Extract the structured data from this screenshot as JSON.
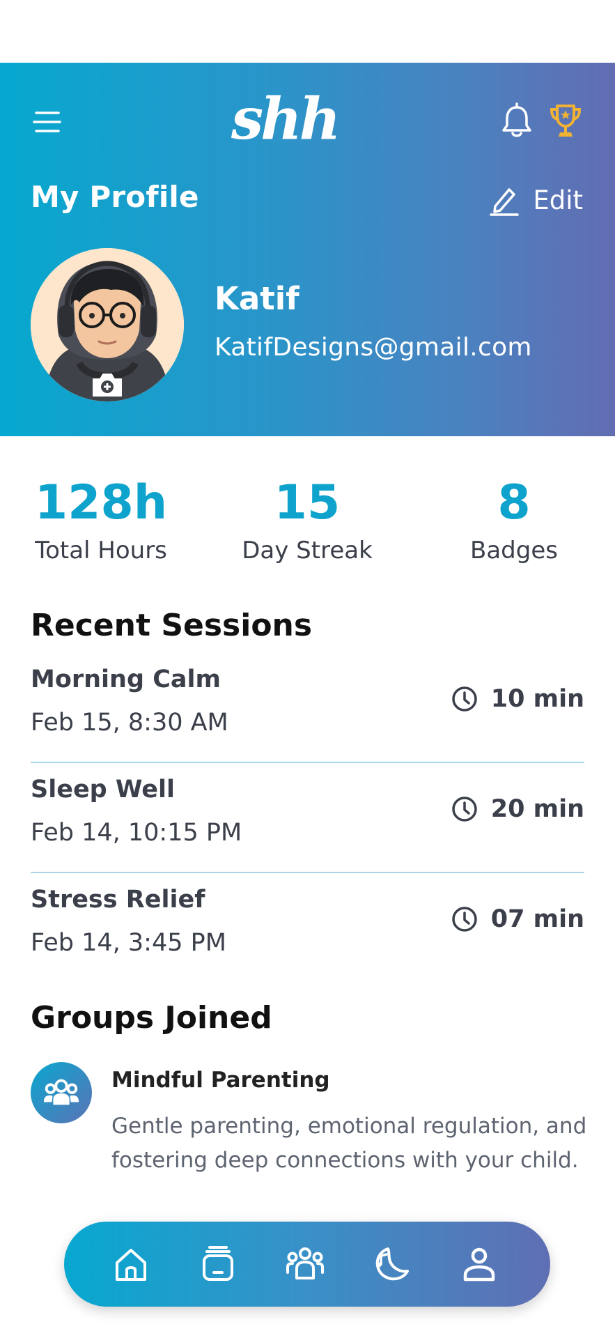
{
  "app": {
    "logo_text": "shh."
  },
  "header": {
    "title": "My Profile",
    "edit_label": "Edit"
  },
  "profile": {
    "name": "Katif",
    "email": "KatifDesigns@gmail.com"
  },
  "stats": [
    {
      "value": "128h",
      "label": "Total Hours"
    },
    {
      "value": "15",
      "label": "Day Streak"
    },
    {
      "value": "8",
      "label": "Badges"
    }
  ],
  "sessions": {
    "title": "Recent Sessions",
    "items": [
      {
        "name": "Morning Calm",
        "date": "Feb 15, 8:30 AM",
        "duration": "10 min"
      },
      {
        "name": "Sleep Well",
        "date": "Feb 14, 10:15 PM",
        "duration": "20 min"
      },
      {
        "name": "Stress Relief",
        "date": "Feb 14, 3:45 PM",
        "duration": "07 min"
      }
    ]
  },
  "groups": {
    "title": "Groups Joined",
    "items": [
      {
        "name": "Mindful Parenting",
        "description": "Gentle parenting, emotional regulation, and fostering deep connections with your child."
      }
    ]
  },
  "nav": {
    "items": [
      {
        "icon": "home-icon"
      },
      {
        "icon": "library-icon"
      },
      {
        "icon": "community-icon"
      },
      {
        "icon": "sleep-music-icon"
      },
      {
        "icon": "profile-icon",
        "active": true
      }
    ]
  },
  "colors": {
    "accent": "#0ea3cc",
    "header_gradient_start": "#06a8cf",
    "header_gradient_end": "#626db2",
    "trophy": "#f2b233",
    "divider": "#a9d7e8"
  }
}
